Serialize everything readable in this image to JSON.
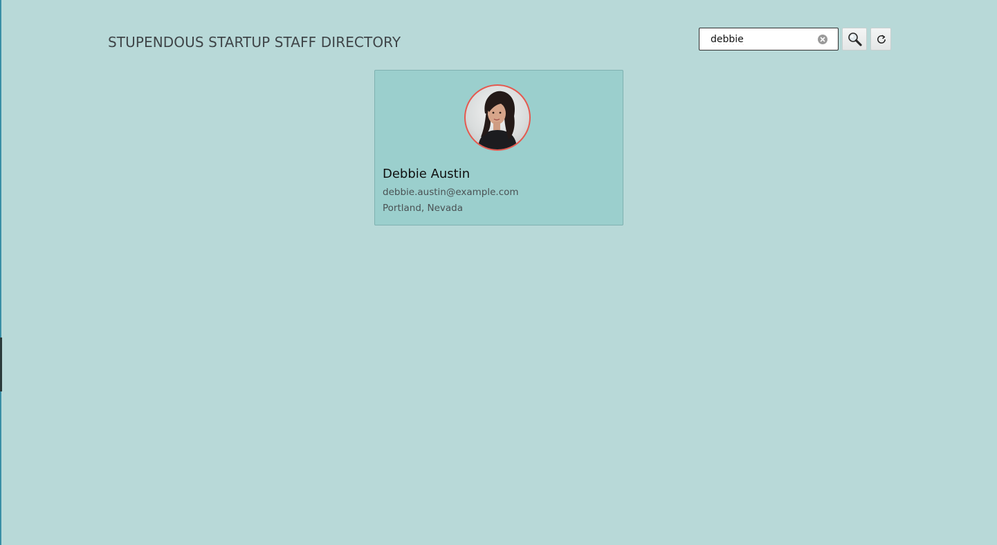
{
  "header": {
    "title": "STUPENDOUS STARTUP STAFF DIRECTORY"
  },
  "search": {
    "value": "debbie",
    "clear_icon": "clear-circle-icon",
    "search_icon": "magnifier-icon",
    "reset_icon": "refresh-icon"
  },
  "employees": [
    {
      "name": "Debbie Austin",
      "email": "debbie.austin@example.com",
      "location": "Portland, Nevada"
    }
  ],
  "colors": {
    "background": "#b8d9d8",
    "card": "#9bcfcd",
    "avatar_border": "#e5594f"
  }
}
